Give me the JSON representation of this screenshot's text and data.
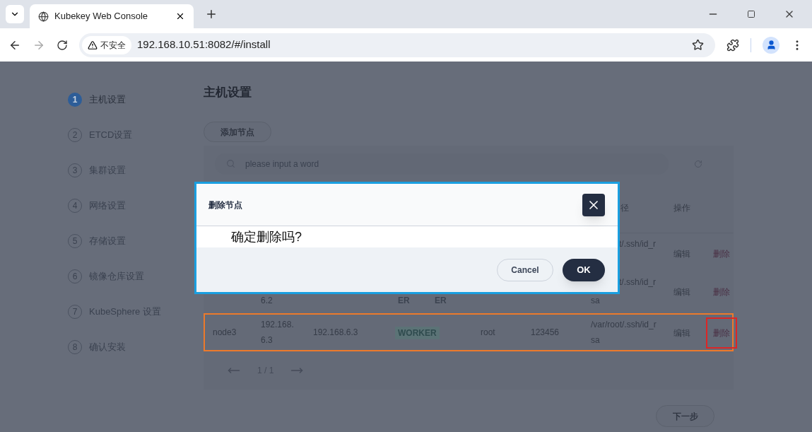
{
  "browser": {
    "tab_title": "Kubekey Web Console",
    "security_label": "不安全",
    "url": "192.168.10.51:8082/#/install"
  },
  "steps": [
    {
      "number": "1",
      "label": "主机设置",
      "selected": true
    },
    {
      "number": "2",
      "label": "ETCD设置",
      "selected": false
    },
    {
      "number": "3",
      "label": "集群设置",
      "selected": false
    },
    {
      "number": "4",
      "label": "网络设置",
      "selected": false
    },
    {
      "number": "5",
      "label": "存储设置",
      "selected": false
    },
    {
      "number": "6",
      "label": "镜像仓库设置",
      "selected": false
    },
    {
      "number": "7",
      "label": "KubeSphere 设置",
      "selected": false
    },
    {
      "number": "8",
      "label": "确认安装",
      "selected": false
    }
  ],
  "page_title": "主机设置",
  "add_button": "添加节点",
  "search": {
    "placeholder": "please input a word"
  },
  "table": {
    "header_cells": [
      {
        "kind": "path",
        "text": "径"
      },
      {
        "kind": "actions",
        "text": "操作"
      }
    ],
    "rows": [
      {
        "kind": "covered",
        "selected": false,
        "path_tail": "t/.ssh/id_r",
        "edit": "编辑",
        "delete": "删除",
        "delete_focused": false
      },
      {
        "kind": "covered",
        "selected": false,
        "address_second": "6.2",
        "role_tails": [
          "ER",
          "ER"
        ],
        "path_tail": "t/.ssh/id_r",
        "path_second": "sa",
        "edit": "编辑",
        "delete": "删除",
        "delete_focused": false
      },
      {
        "kind": "full",
        "selected": true,
        "name": "node3",
        "address_lines": [
          "192.168.",
          "6.3"
        ],
        "internal_address": "192.168.6.3",
        "role": "WORKER",
        "user": "root",
        "password": "123456",
        "path_lines": [
          "/var/root/.ssh/id_r",
          "sa"
        ],
        "edit": "编辑",
        "delete": "删除",
        "delete_focused": true
      }
    ],
    "pagination": {
      "page": "1 / 1"
    }
  },
  "next_button": "下一步",
  "dialog": {
    "title": "删除节点",
    "message": "确定删除吗?",
    "cancel": "Cancel",
    "ok": "OK"
  }
}
